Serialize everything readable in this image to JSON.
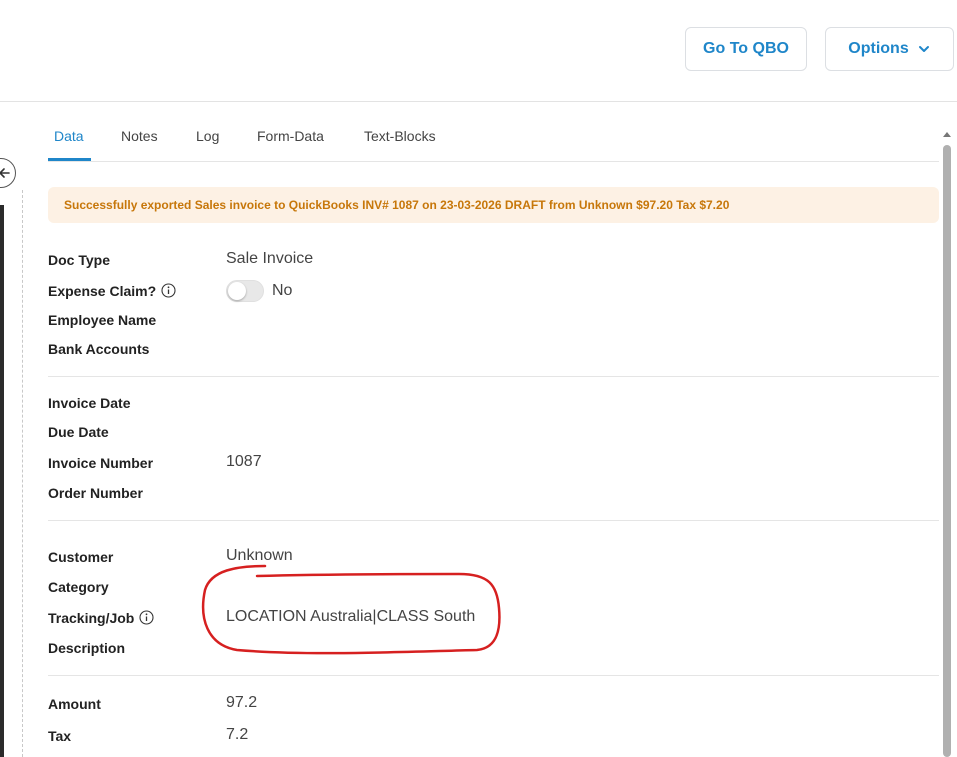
{
  "header": {
    "go_to_qbo": "Go To QBO",
    "options": "Options"
  },
  "tabs": [
    "Data",
    "Notes",
    "Log",
    "Form-Data",
    "Text-Blocks"
  ],
  "alert": {
    "text": "Successfully exported Sales invoice to QuickBooks INV# 1087 on 23-03-2026 DRAFT from Unknown $97.20 Tax $7.20"
  },
  "fields": {
    "doc_type": {
      "label": "Doc Type",
      "value": "Sale Invoice"
    },
    "expense_claim": {
      "label": "Expense Claim?",
      "value": "No",
      "toggle_on": false
    },
    "employee_name": {
      "label": "Employee Name"
    },
    "bank_accounts": {
      "label": "Bank Accounts"
    },
    "invoice_date": {
      "label": "Invoice Date"
    },
    "due_date": {
      "label": "Due Date"
    },
    "invoice_number": {
      "label": "Invoice Number",
      "value": "1087"
    },
    "order_number": {
      "label": "Order Number"
    },
    "customer": {
      "label": "Customer",
      "value": "Unknown"
    },
    "category": {
      "label": "Category"
    },
    "tracking_job": {
      "label": "Tracking/Job",
      "value": "LOCATION Australia|CLASS South"
    },
    "description": {
      "label": "Description"
    },
    "amount": {
      "label": "Amount",
      "value": "97.2"
    },
    "tax": {
      "label": "Tax",
      "value": "7.2"
    }
  },
  "colors": {
    "accent": "#1f86c9",
    "alert_bg": "#fdf1e4",
    "alert_text": "#c7770a",
    "annotation": "#d62020"
  },
  "icons": [
    "chevron-down-icon",
    "back-arrow-icon",
    "info-icon",
    "scroll-up-icon"
  ]
}
